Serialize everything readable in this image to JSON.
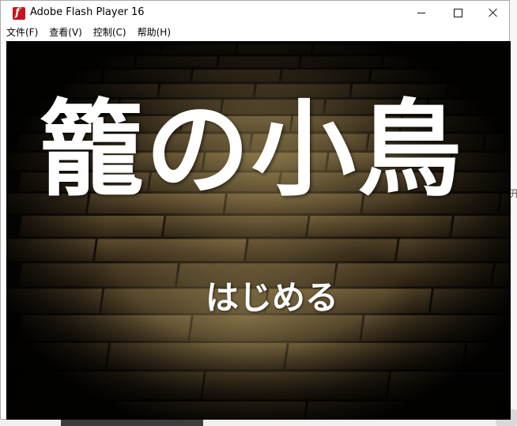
{
  "window": {
    "title": "Adobe Flash Player 16",
    "menu": [
      {
        "label": "文件(F)"
      },
      {
        "label": "查看(V)"
      },
      {
        "label": "控制(C)"
      },
      {
        "label": "帮助(H)"
      }
    ]
  },
  "game": {
    "title": "籠の小鳥",
    "start_label": "はじめる"
  },
  "background": {
    "right_edge_glyph": "开"
  },
  "icons": {
    "app": "flash-player-icon",
    "minimize": "minimize-icon",
    "maximize": "maximize-icon",
    "close": "close-icon"
  },
  "colors": {
    "flash_icon": "#c5141b",
    "stage_background": "#000000",
    "brick_light": "#8a7140",
    "brick_dark": "#2a2013",
    "title_text": "#ffffff"
  }
}
